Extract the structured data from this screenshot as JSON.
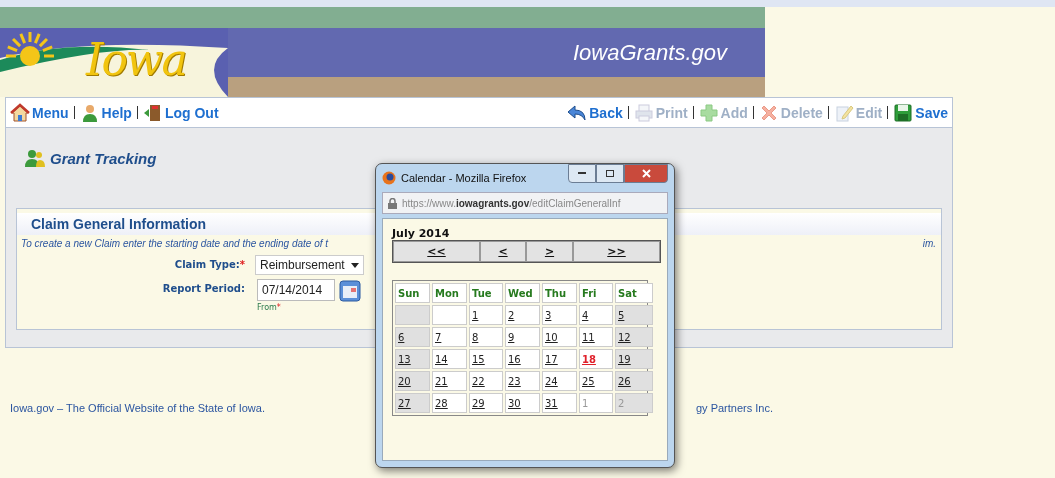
{
  "header": {
    "logo_text": "Iowa",
    "site_title": "IowaGrants.gov"
  },
  "nav_left": [
    {
      "label": "Menu",
      "kind": "house",
      "disabled": false
    },
    {
      "label": "Help",
      "kind": "person",
      "disabled": false
    },
    {
      "label": "Log Out",
      "kind": "door",
      "disabled": false
    }
  ],
  "nav_right": [
    {
      "label": "Back",
      "kind": "back",
      "disabled": false
    },
    {
      "label": "Print",
      "kind": "print",
      "disabled": true
    },
    {
      "label": "Add",
      "kind": "add",
      "disabled": true
    },
    {
      "label": "Delete",
      "kind": "delete",
      "disabled": true
    },
    {
      "label": "Edit",
      "kind": "edit",
      "disabled": true
    },
    {
      "label": "Save",
      "kind": "save",
      "disabled": false
    }
  ],
  "page_title": "Grant Tracking",
  "section": {
    "title": "Claim General Information",
    "intro_left": "To create a new Claim enter the starting date and the ending date of t",
    "intro_right": "im.",
    "claim_type": {
      "label": "Claim Type:",
      "required_mark": "*",
      "value": "Reimbursement"
    },
    "report_period": {
      "label": "Report Period:",
      "from_value": "07/14/2014",
      "from_caption": "From",
      "required_mark": "*"
    }
  },
  "footer": {
    "left": "Iowa.gov – The Official Website of the State of Iowa.",
    "right": "gy Partners Inc."
  },
  "popup": {
    "title": "Calendar - Mozilla Firefox",
    "url_plain_start": "https://www.",
    "url_bold": "iowagrants.gov",
    "url_rest": "/editClaimGeneralInf",
    "month": "July 2014",
    "nav": [
      "<<",
      "<",
      ">",
      ">>"
    ],
    "weekdays": [
      "Sun",
      "Mon",
      "Tue",
      "Wed",
      "Thu",
      "Fri",
      "Sat"
    ],
    "weeks": [
      [
        {
          "kind": "empty",
          "today": false
        },
        {
          "kind": "empty",
          "today": false
        },
        {
          "kind": "day",
          "text": "1",
          "today": false
        },
        {
          "kind": "day",
          "text": "2",
          "today": false
        },
        {
          "kind": "day",
          "text": "3",
          "today": false
        },
        {
          "kind": "day",
          "text": "4",
          "today": false
        },
        {
          "kind": "day",
          "text": "5",
          "today": false
        }
      ],
      [
        {
          "kind": "day",
          "text": "6",
          "today": false
        },
        {
          "kind": "day",
          "text": "7",
          "today": false
        },
        {
          "kind": "day",
          "text": "8",
          "today": false
        },
        {
          "kind": "day",
          "text": "9",
          "today": false
        },
        {
          "kind": "day",
          "text": "10",
          "today": false
        },
        {
          "kind": "day",
          "text": "11",
          "today": false
        },
        {
          "kind": "day",
          "text": "12",
          "today": false
        }
      ],
      [
        {
          "kind": "day",
          "text": "13",
          "today": false
        },
        {
          "kind": "day",
          "text": "14",
          "today": false
        },
        {
          "kind": "day",
          "text": "15",
          "today": false
        },
        {
          "kind": "day",
          "text": "16",
          "today": false
        },
        {
          "kind": "day",
          "text": "17",
          "today": false
        },
        {
          "kind": "day",
          "text": "18",
          "today": true
        },
        {
          "kind": "day",
          "text": "19",
          "today": false
        }
      ],
      [
        {
          "kind": "day",
          "text": "20",
          "today": false
        },
        {
          "kind": "day",
          "text": "21",
          "today": false
        },
        {
          "kind": "day",
          "text": "22",
          "today": false
        },
        {
          "kind": "day",
          "text": "23",
          "today": false
        },
        {
          "kind": "day",
          "text": "24",
          "today": false
        },
        {
          "kind": "day",
          "text": "25",
          "today": false
        },
        {
          "kind": "day",
          "text": "26",
          "today": false
        }
      ],
      [
        {
          "kind": "day",
          "text": "27",
          "today": false
        },
        {
          "kind": "day",
          "text": "28",
          "today": false
        },
        {
          "kind": "day",
          "text": "29",
          "today": false
        },
        {
          "kind": "day",
          "text": "30",
          "today": false
        },
        {
          "kind": "day",
          "text": "31",
          "today": false
        },
        {
          "kind": "adjacent",
          "text": "1",
          "today": false
        },
        {
          "kind": "adjacent",
          "text": "2",
          "today": false
        }
      ]
    ]
  }
}
